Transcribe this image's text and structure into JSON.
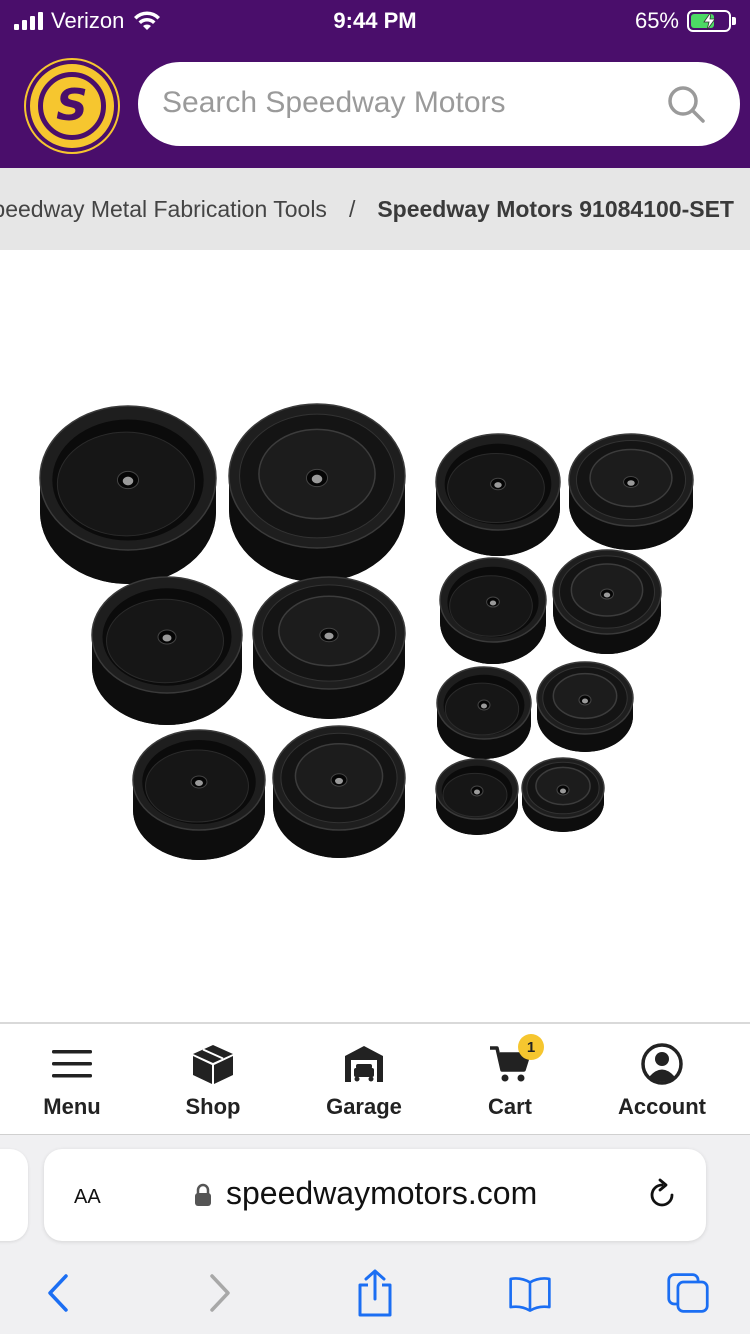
{
  "status_bar": {
    "carrier": "Verizon",
    "time": "9:44 PM",
    "battery_percent": "65%",
    "battery_level": 0.65,
    "charging": true
  },
  "header": {
    "logo_letter": "S",
    "search_placeholder": "Search Speedway Motors",
    "icon": "search-icon",
    "brand_color": "#4a0e6b",
    "accent_color": "#f6c62f"
  },
  "breadcrumb": {
    "items": [
      "Speedway Metal Fabrication Tools",
      "Speedway Motors 91084100-SET"
    ],
    "separator": "/"
  },
  "bottom_nav": {
    "items": [
      {
        "label": "Menu",
        "icon": "hamburger-icon"
      },
      {
        "label": "Shop",
        "icon": "box-icon"
      },
      {
        "label": "Garage",
        "icon": "garage-icon"
      },
      {
        "label": "Cart",
        "icon": "cart-icon",
        "badge": "1"
      },
      {
        "label": "Account",
        "icon": "account-icon"
      }
    ]
  },
  "browser": {
    "aa_label": "AA",
    "domain": "speedwaymotors.com",
    "toolbar_icons": [
      "back-icon",
      "forward-icon",
      "share-icon",
      "bookmarks-icon",
      "tabs-icon"
    ]
  }
}
